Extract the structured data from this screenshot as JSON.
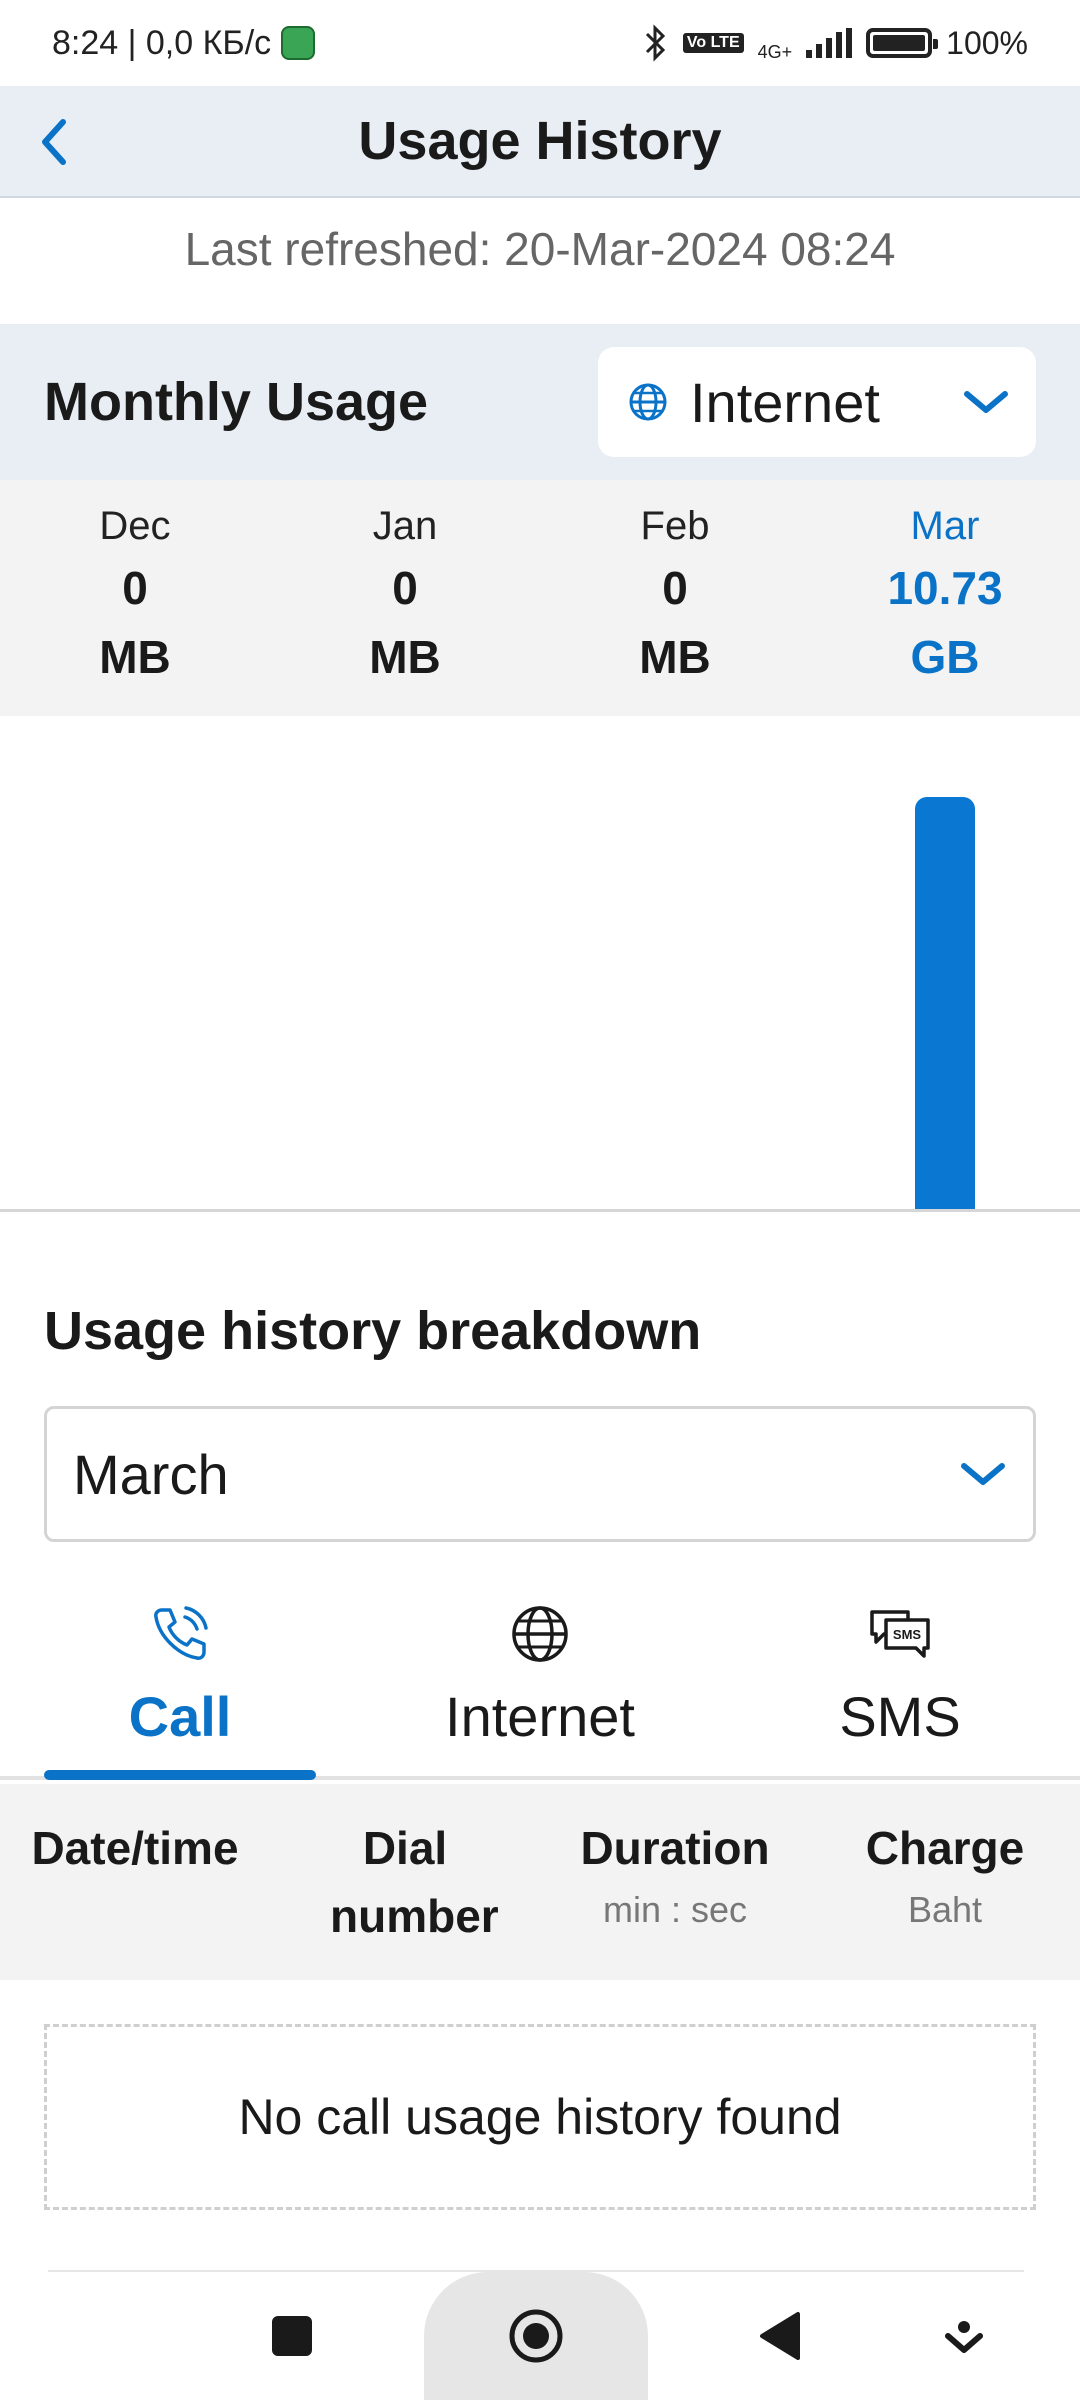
{
  "status_bar": {
    "time_info": "8:24 | 0,0 КБ/с",
    "network": "4G+",
    "volte": "Vo LTE",
    "battery": "100%"
  },
  "header": {
    "title": "Usage History"
  },
  "refreshed": "Last refreshed: 20-Mar-2024 08:24",
  "monthly": {
    "title": "Monthly Usage",
    "type_selected": "Internet",
    "months": [
      {
        "name": "Dec",
        "value": "0",
        "unit": "MB",
        "usage_gb": 0
      },
      {
        "name": "Jan",
        "value": "0",
        "unit": "MB",
        "usage_gb": 0
      },
      {
        "name": "Feb",
        "value": "0",
        "unit": "MB",
        "usage_gb": 0
      },
      {
        "name": "Mar",
        "value": "10.73",
        "unit": "GB",
        "usage_gb": 10.73
      }
    ],
    "active_color": "#0a73c8"
  },
  "breakdown": {
    "title": "Usage history breakdown",
    "month_selected": "March",
    "tabs": [
      {
        "label": "Call",
        "icon": "phone-icon"
      },
      {
        "label": "Internet",
        "icon": "globe-icon"
      },
      {
        "label": "SMS",
        "icon": "sms-icon"
      }
    ],
    "columns": [
      {
        "label": "Date/time",
        "sub": ""
      },
      {
        "label": "Dial number",
        "sub": ""
      },
      {
        "label": "Duration",
        "sub": "min : sec"
      },
      {
        "label": "Charge",
        "sub": "Baht"
      }
    ],
    "empty_message": "No call usage history found"
  }
}
